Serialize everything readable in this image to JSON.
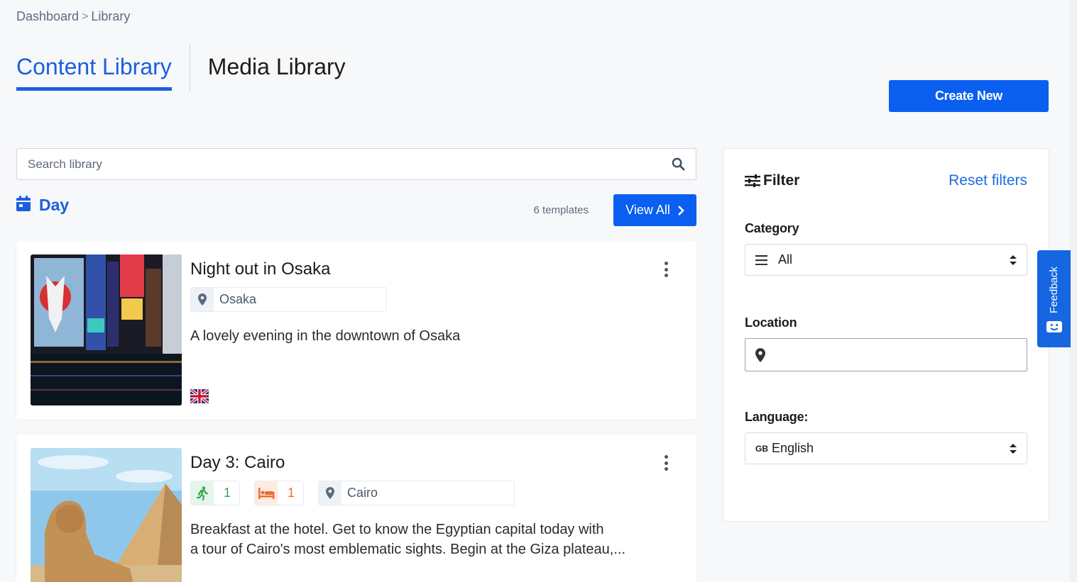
{
  "breadcrumb": {
    "items": [
      "Dashboard",
      "Library"
    ],
    "separator": ">"
  },
  "tabs": [
    {
      "label": "Content Library",
      "active": true
    },
    {
      "label": "Media Library",
      "active": false
    }
  ],
  "actions": {
    "create_new": "Create New"
  },
  "search": {
    "placeholder": "Search library",
    "value": ""
  },
  "section": {
    "title": "Day",
    "icon": "calendar-icon",
    "count_label": "6 templates",
    "view_all": "View All"
  },
  "cards": [
    {
      "title": "Night out in Osaka",
      "location": "Osaka",
      "description": "A lovely evening in the downtown of Osaka",
      "language_flag": "uk-flag-icon"
    },
    {
      "title": "Day 3: Cairo",
      "activities": "1",
      "accommodations": "1",
      "location": "Cairo",
      "description_line1": "Breakfast at the hotel. Get to know the Egyptian capital today with",
      "description_line2": "a tour of Cairo's most emblematic sights. Begin at the Giza plateau,..."
    }
  ],
  "filter": {
    "title": "Filter",
    "reset": "Reset filters",
    "category_label": "Category",
    "category_value": "All",
    "location_label": "Location",
    "location_value": "",
    "language_label": "Language:",
    "language_code": "GB",
    "language_value": "English"
  },
  "feedback": {
    "label": "Feedback"
  },
  "colors": {
    "primary": "#0a5ef0",
    "link": "#1b6fe0",
    "activity": "#34a853",
    "accommodation": "#ef6c2e"
  }
}
